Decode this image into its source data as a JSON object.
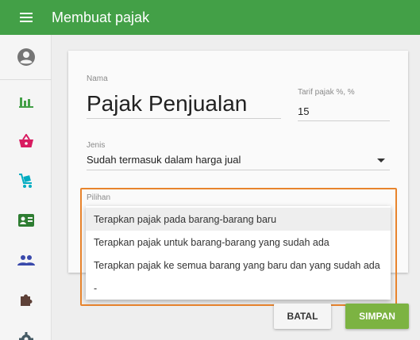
{
  "header": {
    "title": "Membuat pajak",
    "menu_icon": "hamburger-menu-icon",
    "color": "#43a047"
  },
  "sidebar": {
    "items": [
      {
        "icon": "account-circle-icon",
        "color": "#757575"
      },
      {
        "icon": "bar-chart-icon",
        "color": "#43a047"
      },
      {
        "icon": "shopping-basket-icon",
        "color": "#d81b60"
      },
      {
        "icon": "cart-icon",
        "color": "#00acc1"
      },
      {
        "icon": "contact-card-icon",
        "color": "#2e7d32"
      },
      {
        "icon": "people-icon",
        "color": "#3949ab"
      },
      {
        "icon": "puzzle-icon",
        "color": "#5d4037"
      },
      {
        "icon": "gear-icon",
        "color": "#455a64"
      }
    ]
  },
  "form": {
    "name_label": "Nama",
    "name_value": "Pajak Penjualan",
    "rate_label": "Tarif pajak %, %",
    "rate_value": "15",
    "jenis_label": "Jenis",
    "jenis_value": "Sudah termasuk dalam harga jual",
    "pilihan_label": "Pilihan",
    "pilihan_options": [
      "Terapkan pajak pada barang-barang baru",
      "Terapkan pajak untuk barang-barang yang sudah ada",
      "Terapkan pajak ke semua barang yang baru dan yang sudah ada",
      "-"
    ],
    "selected_option_index": 0
  },
  "actions": {
    "cancel_label": "BATAL",
    "save_label": "SIMPAN",
    "save_color": "#7cb342"
  },
  "highlight_color": "#e8842d"
}
